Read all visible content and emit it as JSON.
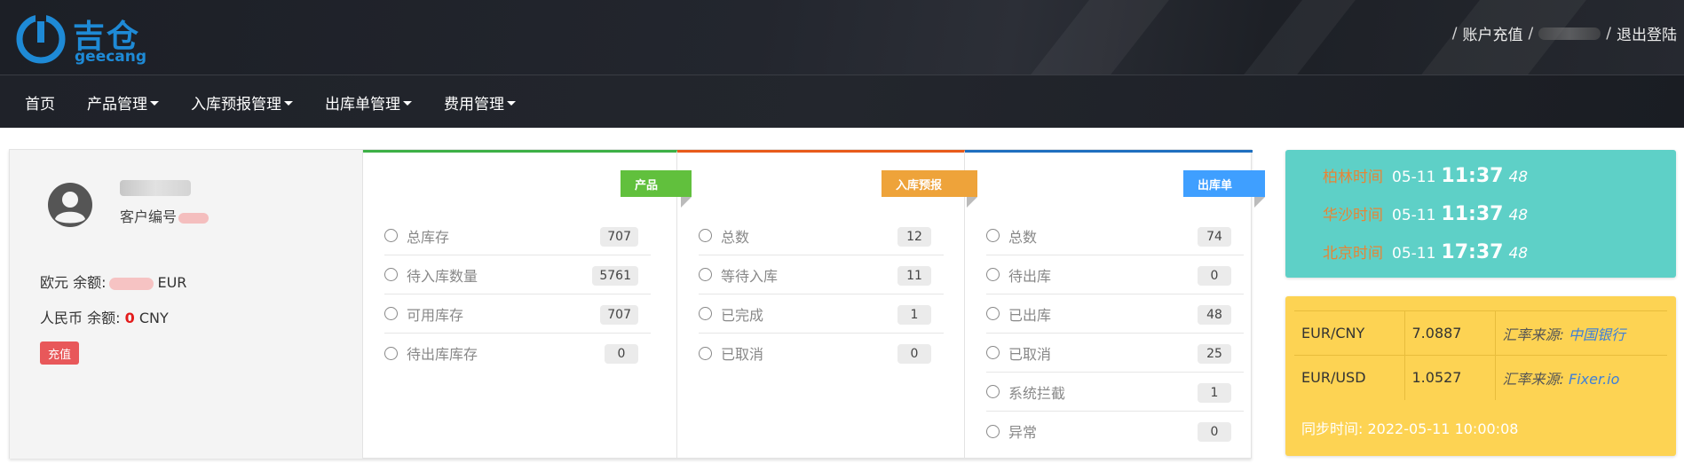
{
  "brand": {
    "name_cn": "吉仓",
    "name_en": "geecang",
    "accent": "#1e8ad6"
  },
  "top_links": {
    "recharge": "账户充值",
    "logout": "退出登陆"
  },
  "nav": [
    {
      "label": "首页"
    },
    {
      "label": "产品管理"
    },
    {
      "label": "入库预报管理"
    },
    {
      "label": "出库单管理"
    },
    {
      "label": "费用管理"
    }
  ],
  "profile": {
    "customer_no_label": "客户编号",
    "eur_label": "欧元 余额:",
    "eur_unit": "EUR",
    "cny_label": "人民币 余额:",
    "cny_value": "0",
    "cny_unit": "CNY",
    "recharge_button": "充值"
  },
  "products": {
    "tag": "产品",
    "color": "#61c03d",
    "rows": [
      {
        "label": "总库存",
        "value": "707"
      },
      {
        "label": "待入库数量",
        "value": "5761"
      },
      {
        "label": "可用库存",
        "value": "707"
      },
      {
        "label": "待出库库存",
        "value": "0"
      }
    ]
  },
  "inbound": {
    "tag": "入库预报",
    "color": "#eea33a",
    "rows": [
      {
        "label": "总数",
        "value": "12"
      },
      {
        "label": "等待入库",
        "value": "11"
      },
      {
        "label": "已完成",
        "value": "1"
      },
      {
        "label": "已取消",
        "value": "0"
      }
    ]
  },
  "outbound": {
    "tag": "出库单",
    "color": "#3f9fff",
    "rows": [
      {
        "label": "总数",
        "value": "74"
      },
      {
        "label": "待出库",
        "value": "0"
      },
      {
        "label": "已出库",
        "value": "48"
      },
      {
        "label": "已取消",
        "value": "25"
      },
      {
        "label": "系统拦截",
        "value": "1"
      },
      {
        "label": "异常",
        "value": "0"
      }
    ]
  },
  "clocks": [
    {
      "city": "柏林时间",
      "date": "05-11",
      "hm": "11:37",
      "sec": "48"
    },
    {
      "city": "华沙时间",
      "date": "05-11",
      "hm": "11:37",
      "sec": "48"
    },
    {
      "city": "北京时间",
      "date": "05-11",
      "hm": "17:37",
      "sec": "48"
    }
  ],
  "rates": [
    {
      "pair": "EUR/CNY",
      "rate": "7.0887",
      "source_label": "汇率来源:",
      "source": "中国银行"
    },
    {
      "pair": "EUR/USD",
      "rate": "1.0527",
      "source_label": "汇率来源:",
      "source": "Fixer.io"
    }
  ],
  "sync": {
    "label": "同步时间:",
    "value": "2022-05-11 10:00:08"
  }
}
